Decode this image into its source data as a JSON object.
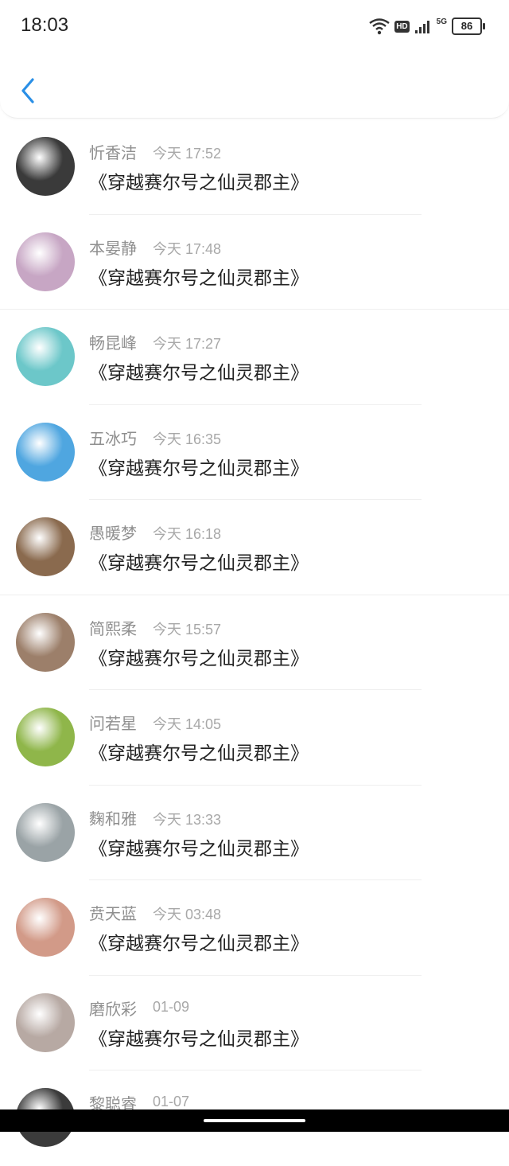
{
  "status_bar": {
    "time": "18:03",
    "battery": "86",
    "hd_label": "HD",
    "network_label": "5G"
  },
  "messages": [
    {
      "name": "忻香洁",
      "time": "今天 17:52",
      "title": "《穿越赛尔号之仙灵郡主》",
      "avatar_color": "#3a3a3a"
    },
    {
      "name": "本晏静",
      "time": "今天 17:48",
      "title": "《穿越赛尔号之仙灵郡主》",
      "avatar_color": "#c7a6c4"
    },
    {
      "name": "畅昆峰",
      "time": "今天 17:27",
      "title": "《穿越赛尔号之仙灵郡主》",
      "avatar_color": "#6cc7c9"
    },
    {
      "name": "五冰巧",
      "time": "今天 16:35",
      "title": "《穿越赛尔号之仙灵郡主》",
      "avatar_color": "#4fa6e0"
    },
    {
      "name": "愚暖梦",
      "time": "今天 16:18",
      "title": "《穿越赛尔号之仙灵郡主》",
      "avatar_color": "#8a6a4e"
    },
    {
      "name": "简熙柔",
      "time": "今天 15:57",
      "title": "《穿越赛尔号之仙灵郡主》",
      "avatar_color": "#9c7f6a"
    },
    {
      "name": "问若星",
      "time": "今天 14:05",
      "title": "《穿越赛尔号之仙灵郡主》",
      "avatar_color": "#8fb64a"
    },
    {
      "name": "麴和雅",
      "time": "今天 13:33",
      "title": "《穿越赛尔号之仙灵郡主》",
      "avatar_color": "#9aa3a6"
    },
    {
      "name": "贲天蓝",
      "time": "今天 03:48",
      "title": "《穿越赛尔号之仙灵郡主》",
      "avatar_color": "#d29a88"
    },
    {
      "name": "磨欣彩",
      "time": "01-09",
      "title": "《穿越赛尔号之仙灵郡主》",
      "avatar_color": "#b7a9a3"
    },
    {
      "name": "黎聪睿",
      "time": "01-07",
      "title": "",
      "avatar_color": "#3b3b3b"
    }
  ]
}
